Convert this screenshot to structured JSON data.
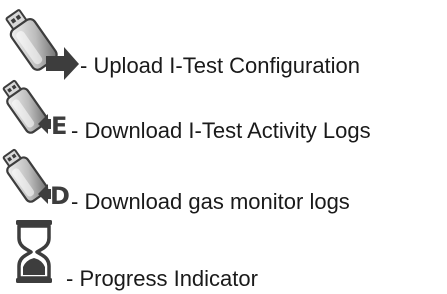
{
  "legend": {
    "items": [
      {
        "icon": "usb-upload-arrow-icon",
        "label": "- Upload I-Test Configuration"
      },
      {
        "icon": "usb-download-e-icon",
        "badge": "E",
        "label": "- Download I-Test Activity Logs"
      },
      {
        "icon": "usb-download-d-icon",
        "badge": "D",
        "label": "- Download gas monitor logs"
      },
      {
        "icon": "hourglass-icon",
        "label": "- Progress Indicator"
      }
    ]
  },
  "colors": {
    "icon_dark": "#3d3d3d",
    "icon_mid": "#8a8a8a",
    "icon_light": "#e6e6e6",
    "text": "#1a1a1a",
    "background": "#ffffff"
  }
}
